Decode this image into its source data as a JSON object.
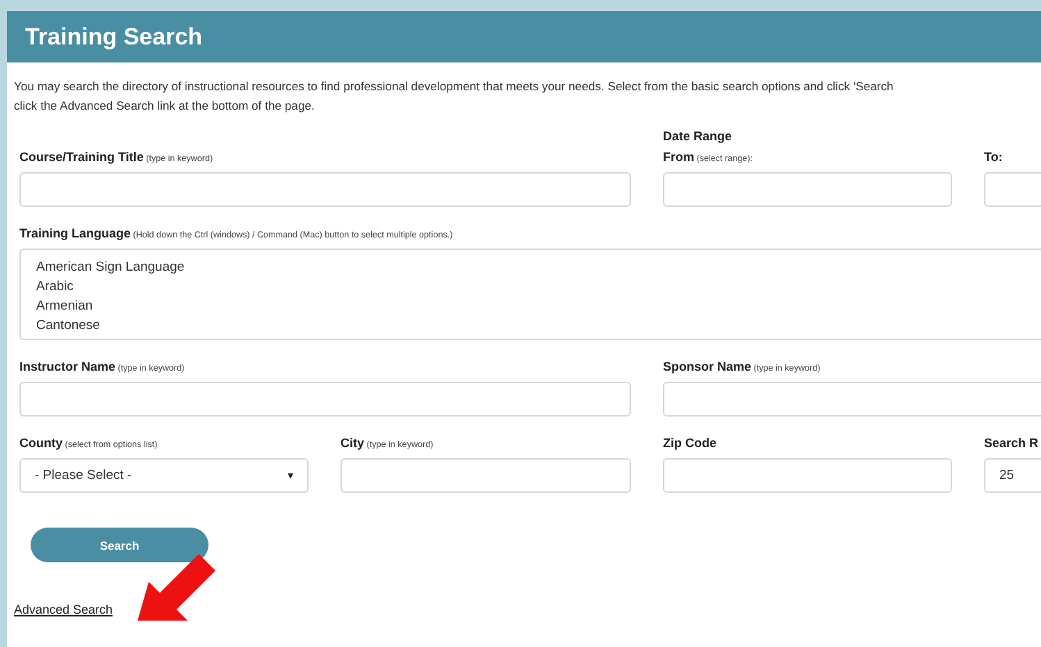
{
  "header": {
    "title": "Training Search"
  },
  "intro_lines": [
    "You may search the directory of instructional resources to find professional development that meets your needs. Select from the basic search options and click 'Search",
    "click the Advanced Search link at the bottom of the page."
  ],
  "date_range_heading": "Date Range",
  "rows": [
    {
      "fields": [
        {
          "kind": "text",
          "label": "Course/Training Title",
          "hint": "(type in keyword)"
        },
        {
          "kind": "text",
          "label": "From",
          "hint": "(select range):"
        },
        {
          "kind": "text",
          "label": "To:"
        }
      ]
    },
    {
      "fields": [
        {
          "kind": "listbox",
          "label": "Training Language",
          "hint": "(Hold down the Ctrl (windows) / Command (Mac) button to select multiple options.)",
          "options": [
            "American Sign Language",
            "Arabic",
            "Armenian",
            "Cantonese"
          ]
        }
      ]
    },
    {
      "fields": [
        {
          "kind": "text",
          "label": "Instructor Name",
          "hint": "(type in keyword)"
        },
        {
          "kind": "text",
          "label": "Sponsor Name",
          "hint": "(type in keyword)"
        }
      ]
    },
    {
      "fields": [
        {
          "kind": "select",
          "label": "County",
          "hint": "(select from options list)",
          "value": "- Please Select -",
          "caret": "▾"
        },
        {
          "kind": "text",
          "label": "City",
          "hint": "(type in keyword)"
        },
        {
          "kind": "text",
          "label": "Zip Code"
        },
        {
          "kind": "text",
          "label": "Search R",
          "value": "25"
        }
      ]
    }
  ],
  "search_button": "Search",
  "advanced_link": "Advanced Search"
}
